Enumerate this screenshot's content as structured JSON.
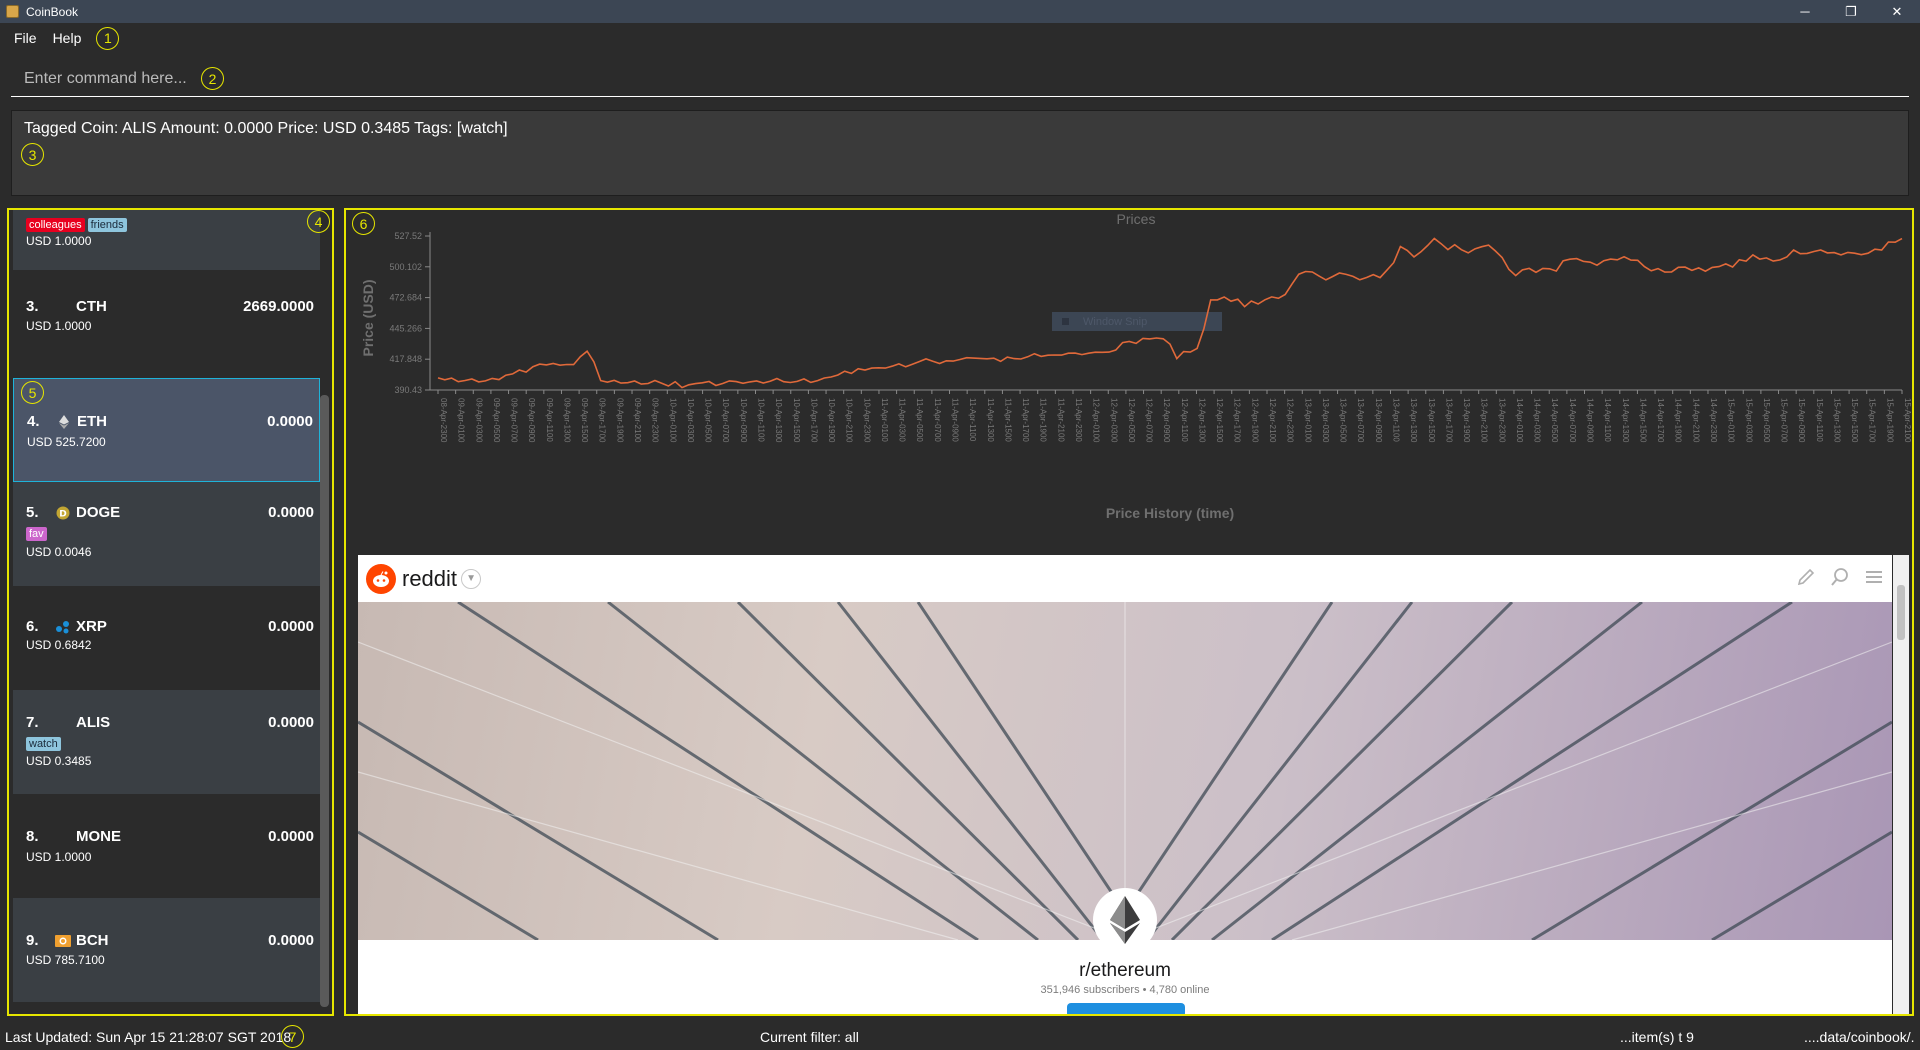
{
  "window": {
    "title": "CoinBook",
    "controls": [
      "─",
      "❐",
      "✕"
    ]
  },
  "menu": {
    "file": "File",
    "help": "Help"
  },
  "annotations": [
    "1",
    "2",
    "3",
    "4",
    "5",
    "6",
    "7"
  ],
  "command": {
    "placeholder": "Enter command here..."
  },
  "result": {
    "text": "Tagged Coin: ALIS Amount: 0.0000 Price: USD 0.3485 Tags: [watch]"
  },
  "coins": [
    {
      "index": "",
      "name": "",
      "amount": "",
      "price": "USD 1.0000",
      "tags": [
        "colleagues",
        "friends"
      ],
      "icon": ""
    },
    {
      "index": "3.",
      "name": "CTH",
      "amount": "2669.0000",
      "price": "USD 1.0000",
      "tags": [],
      "icon": ""
    },
    {
      "index": "4.",
      "name": "ETH",
      "amount": "0.0000",
      "price": "USD 525.7200",
      "tags": [],
      "icon": "ethereum-icon"
    },
    {
      "index": "5.",
      "name": "DOGE",
      "amount": "0.0000",
      "price": "USD 0.0046",
      "tags": [
        "fav"
      ],
      "icon": "dogecoin-icon"
    },
    {
      "index": "6.",
      "name": "XRP",
      "amount": "0.0000",
      "price": "USD 0.6842",
      "tags": [],
      "icon": "ripple-icon"
    },
    {
      "index": "7.",
      "name": "ALIS",
      "amount": "0.0000",
      "price": "USD 0.3485",
      "tags": [
        "watch"
      ],
      "icon": ""
    },
    {
      "index": "8.",
      "name": "MONE",
      "amount": "0.0000",
      "price": "USD 1.0000",
      "tags": [],
      "icon": ""
    },
    {
      "index": "9.",
      "name": "BCH",
      "amount": "0.0000",
      "price": "USD 785.7100",
      "tags": [],
      "icon": "bitcoin-cash-icon"
    }
  ],
  "chart_data": {
    "type": "line",
    "title": "Prices",
    "xlabel": "Price History (time)",
    "ylabel": "Price (USD)",
    "ylim": [
      390.43,
      527.52
    ],
    "yticks": [
      "390.43",
      "417.848",
      "445.266",
      "472.684",
      "500.102",
      "527.52"
    ],
    "legend": "Window Snip",
    "values": [
      401.2,
      399.5,
      401.0,
      397.8,
      398.9,
      400.2,
      397.6,
      398.5,
      400.8,
      399.7,
      403.6,
      404.8,
      408.2,
      406.4,
      411.2,
      413.5,
      412.8,
      414.0,
      412.5,
      413.1,
      413.0,
      420.1,
      425.0,
      415.5,
      398.8,
      397.4,
      399.0,
      396.6,
      396.9,
      398.4,
      395.7,
      396.2,
      398.9,
      396.5,
      394.0,
      397.8,
      392.6,
      395.1,
      396.1,
      396.8,
      398.0,
      394.4,
      396.2,
      398.5,
      397.9,
      396.4,
      397.6,
      398.4,
      396.7,
      398.2,
      400.7,
      397.8,
      397.1,
      398.1,
      400.3,
      397.2,
      398.8,
      401.1,
      402.0,
      403.8,
      407.2,
      405.2,
      409.4,
      408.2,
      409.9,
      410.2,
      409.9,
      411.6,
      413.7,
      411.1,
      413.3,
      415.7,
      418.1,
      416.0,
      414.0,
      416.4,
      416.2,
      417.6,
      419.2,
      418.8,
      418.6,
      418.2,
      418.7,
      415.9,
      419.7,
      418.4,
      418.0,
      420.0,
      422.7,
      420.3,
      421.4,
      421.6,
      421.5,
      423.2,
      423.3,
      421.9,
      423.2,
      424.1,
      424.0,
      424.2,
      426.0,
      432.6,
      433.6,
      431.9,
      436.4,
      435.9,
      436.7,
      436.0,
      431.3,
      418.4,
      424.6,
      424.2,
      427.5,
      445.1,
      470.6,
      470.6,
      473.2,
      469.5,
      471.3,
      464.6,
      469.7,
      467.0,
      470.7,
      473.3,
      472.1,
      475.4,
      484.7,
      493.5,
      495.9,
      495.5,
      491.8,
      488.4,
      491.5,
      494.6,
      493.3,
      491.6,
      488.5,
      490.6,
      493.2,
      490.5,
      497.1,
      503.8,
      518.2,
      514.7,
      508.9,
      513.4,
      519.1,
      525.3,
      520.7,
      515.4,
      519.8,
      515.3,
      512.5,
      516.1,
      518.0,
      519.4,
      514.3,
      508.4,
      497.8,
      492.3,
      497.3,
      498.7,
      495.2,
      498.7,
      498.3,
      496.3,
      505.4,
      506.9,
      507.4,
      504.9,
      504.2,
      501.5,
      505.5,
      507.0,
      506.3,
      509.0,
      506.1,
      505.9,
      500.3,
      496.5,
      498.5,
      495.4,
      495.6,
      499.7,
      499.8,
      496.9,
      499.1,
      496.2,
      499.6,
      500.3,
      502.7,
      499.9,
      506.4,
      505.2,
      510.7,
      507.0,
      508.0,
      505.2,
      506.2,
      508.8,
      515.1,
      511.8,
      512.0,
      513.7,
      515.1,
      512.5,
      512.7,
      510.7,
      512.9,
      512.2,
      510.9,
      512.2,
      515.8,
      515.1,
      522.2,
      522.0,
      525.2
    ],
    "x_tick_labels": [
      "08-Apr-2300",
      "09-Apr-0100",
      "09-Apr-0300",
      "09-Apr-0500",
      "09-Apr-0700",
      "09-Apr-0900",
      "09-Apr-1100",
      "09-Apr-1300",
      "09-Apr-1500",
      "09-Apr-1700",
      "09-Apr-1900",
      "09-Apr-2100",
      "09-Apr-2300",
      "10-Apr-0100",
      "10-Apr-0300",
      "10-Apr-0500",
      "10-Apr-0700",
      "10-Apr-0900",
      "10-Apr-1100",
      "10-Apr-1300",
      "10-Apr-1500",
      "10-Apr-1700",
      "10-Apr-1900",
      "10-Apr-2100",
      "10-Apr-2300",
      "11-Apr-0100",
      "11-Apr-0300",
      "11-Apr-0500",
      "11-Apr-0700",
      "11-Apr-0900",
      "11-Apr-1100",
      "11-Apr-1300",
      "11-Apr-1500",
      "11-Apr-1700",
      "11-Apr-1900",
      "11-Apr-2100",
      "11-Apr-2300",
      "12-Apr-0100",
      "12-Apr-0300",
      "12-Apr-0500",
      "12-Apr-0700",
      "12-Apr-0900",
      "12-Apr-1100",
      "12-Apr-1300",
      "12-Apr-1500",
      "12-Apr-1700",
      "12-Apr-1900",
      "12-Apr-2100",
      "12-Apr-2300",
      "13-Apr-0100",
      "13-Apr-0300",
      "13-Apr-0500",
      "13-Apr-0700",
      "13-Apr-0900",
      "13-Apr-1100",
      "13-Apr-1300",
      "13-Apr-1500",
      "13-Apr-1700",
      "13-Apr-1900",
      "13-Apr-2100",
      "13-Apr-2300",
      "14-Apr-0100",
      "14-Apr-0300",
      "14-Apr-0500",
      "14-Apr-0700",
      "14-Apr-0900",
      "14-Apr-1100",
      "14-Apr-1300",
      "14-Apr-1500",
      "14-Apr-1700",
      "14-Apr-1900",
      "14-Apr-2100",
      "14-Apr-2300",
      "15-Apr-0100",
      "15-Apr-0300",
      "15-Apr-0500",
      "15-Apr-0700",
      "15-Apr-0900",
      "15-Apr-1100",
      "15-Apr-1300",
      "15-Apr-1500",
      "15-Apr-1700",
      "15-Apr-1900",
      "15-Apr-2100"
    ],
    "grid": false,
    "line_color": "#e0693a"
  },
  "browser": {
    "brand": "reddit",
    "subreddit": "r/ethereum",
    "meta": "351,946 subscribers • 4,780 online"
  },
  "status": {
    "last_updated": "Last Updated: Sun Apr 15 21:28:07 SGT 2018",
    "filter": "Current filter: all",
    "items": "...item(s) t 9",
    "path": "....data/coinbook/."
  },
  "colors": {
    "accent_yellow": "#e6e600",
    "selected_border": "#1fb3d9",
    "selected_bg": "#4b5568"
  }
}
